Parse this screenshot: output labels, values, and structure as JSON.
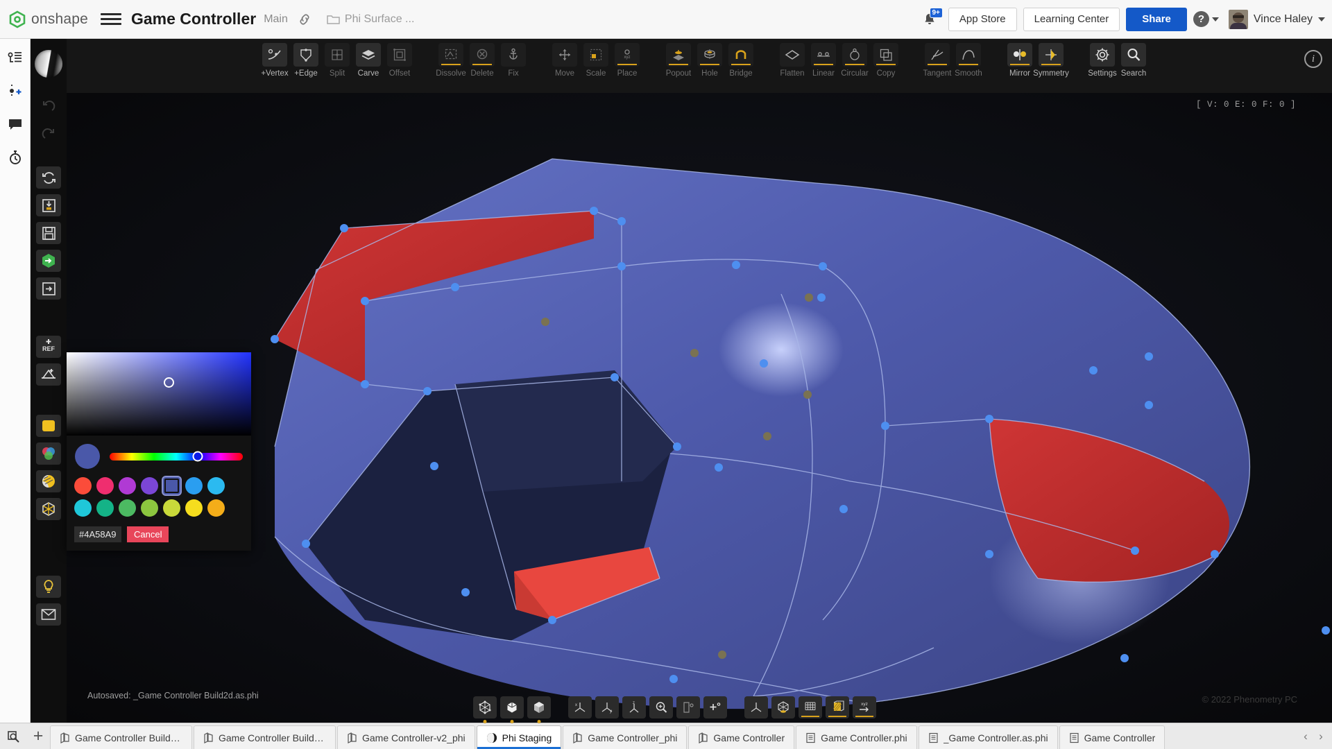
{
  "header": {
    "brand": "onshape",
    "menu_icon": "hamburger-icon",
    "document_title": "Game Controller",
    "branch": "Main",
    "link_icon": "link-icon",
    "workspace_folder": "Phi Surface ...",
    "notifications": {
      "icon": "bell-icon",
      "badge": "9+"
    },
    "app_store_label": "App Store",
    "learning_center_label": "Learning Center",
    "share_label": "Share",
    "help_glyph": "?",
    "user_name": "Vince Haley"
  },
  "rail": {
    "items": [
      {
        "name": "feature-tree-icon",
        "label": "Feature list"
      },
      {
        "name": "add-point-icon",
        "label": "Insert"
      },
      {
        "name": "comment-icon",
        "label": "Comments"
      },
      {
        "name": "history-icon",
        "label": "History"
      },
      {
        "name": "search-history-icon",
        "label": "Search history"
      }
    ]
  },
  "vtool": {
    "items": [
      {
        "name": "shading-sphere-icon",
        "style": "sphere"
      },
      {
        "name": "undo-icon",
        "style": "dim"
      },
      {
        "name": "redo-icon",
        "style": "dim"
      },
      {
        "name": "refresh-icon",
        "style": "tile"
      },
      {
        "name": "import-icon",
        "style": "tile"
      },
      {
        "name": "save-icon",
        "style": "tile"
      },
      {
        "name": "onshape-export-icon",
        "style": "tile"
      },
      {
        "name": "export-icon",
        "style": "tile"
      },
      {
        "name": "add-reference-icon",
        "style": "tile",
        "text": "+REF"
      },
      {
        "name": "add-dimension-icon",
        "style": "tile"
      },
      {
        "name": "color-fill-icon",
        "style": "tile"
      },
      {
        "name": "color-wheel-icon",
        "style": "tile"
      },
      {
        "name": "material-icon",
        "style": "tile"
      },
      {
        "name": "bounding-box-icon",
        "style": "tile"
      },
      {
        "name": "light-bulb-icon",
        "style": "tile"
      },
      {
        "name": "envelope-icon",
        "style": "tile"
      }
    ]
  },
  "ribbon": {
    "groups": [
      {
        "name": "edit-group",
        "tools": [
          {
            "label": "+Vertex",
            "icon": "add-vertex-icon",
            "state": "active"
          },
          {
            "label": "+Edge",
            "icon": "add-edge-icon",
            "state": "active"
          },
          {
            "label": "Split",
            "icon": "split-icon",
            "state": "dim"
          },
          {
            "label": "Carve",
            "icon": "carve-icon",
            "state": "active"
          },
          {
            "label": "Offset",
            "icon": "offset-icon",
            "state": "dim"
          }
        ]
      },
      {
        "name": "cleanup-group",
        "tools": [
          {
            "label": "Dissolve",
            "icon": "dissolve-icon",
            "state": "dim",
            "accent": true
          },
          {
            "label": "Delete",
            "icon": "delete-icon",
            "state": "dim",
            "accent": true
          },
          {
            "label": "Fix",
            "icon": "fix-anchor-icon",
            "state": "dim"
          }
        ]
      },
      {
        "name": "transform-group",
        "tools": [
          {
            "label": "Move",
            "icon": "move-icon",
            "state": "dim"
          },
          {
            "label": "Scale",
            "icon": "scale-icon",
            "state": "dim"
          },
          {
            "label": "Place",
            "icon": "place-icon",
            "state": "dim",
            "accent": true
          }
        ]
      },
      {
        "name": "feature-group",
        "tools": [
          {
            "label": "Popout",
            "icon": "popout-icon",
            "state": "dim",
            "accent": true
          },
          {
            "label": "Hole",
            "icon": "hole-icon",
            "state": "dim",
            "accent": true
          },
          {
            "label": "Bridge",
            "icon": "bridge-icon",
            "state": "dim",
            "accent": true
          }
        ]
      },
      {
        "name": "pattern-group",
        "tools": [
          {
            "label": "Flatten",
            "icon": "flatten-icon",
            "state": "dim"
          },
          {
            "label": "Linear",
            "icon": "linear-pattern-icon",
            "state": "dim",
            "accent": true
          },
          {
            "label": "Circular",
            "icon": "circular-pattern-icon",
            "state": "dim",
            "accent": true
          },
          {
            "label": "Copy",
            "icon": "copy-icon",
            "state": "dim",
            "accent": true
          }
        ]
      },
      {
        "name": "continuity-group",
        "tools": [
          {
            "label": "Tangent",
            "icon": "tangent-icon",
            "state": "dim",
            "accent": true
          },
          {
            "label": "Smooth",
            "icon": "smooth-icon",
            "state": "dim",
            "accent": true
          }
        ]
      },
      {
        "name": "symmetry-group",
        "tools": [
          {
            "label": "Mirror",
            "icon": "mirror-icon",
            "state": "active",
            "accent": true
          },
          {
            "label": "Symmetry",
            "icon": "symmetry-icon",
            "state": "active",
            "accent": true
          }
        ]
      },
      {
        "name": "utility-group",
        "tools": [
          {
            "label": "Settings",
            "icon": "gear-icon",
            "state": "active"
          },
          {
            "label": "Search",
            "icon": "search-icon",
            "state": "active"
          }
        ]
      }
    ],
    "info_icon": "info-icon"
  },
  "viewport": {
    "vertex_counter": "[ V: 0 E: 0 F: 0 ]",
    "autosave_status": "Autosaved: _Game Controller Build2d.as.phi",
    "copyright": "© 2022 Phenometry PC",
    "model_colors": {
      "surface_blue": "#4a58a9",
      "highlight_red": "#e03c3c",
      "dark_face": "#1c2240",
      "wire": "#b9c6ef"
    }
  },
  "view_toolbar": {
    "groups": [
      {
        "name": "display-mode-group",
        "items": [
          {
            "icon": "wireframe-view-icon",
            "dot": true
          },
          {
            "icon": "shaded-edges-view-icon",
            "dot": true
          },
          {
            "icon": "shaded-view-icon",
            "dot": true
          }
        ]
      },
      {
        "name": "orientation-group",
        "items": [
          {
            "icon": "axis-x-icon"
          },
          {
            "icon": "axis-y-icon"
          },
          {
            "icon": "axis-z-icon"
          },
          {
            "icon": "zoom-to-fit-icon"
          },
          {
            "icon": "section-view-icon"
          },
          {
            "icon": "add-view-icon"
          }
        ]
      },
      {
        "name": "display-options-group",
        "items": [
          {
            "icon": "origin-axes-icon"
          },
          {
            "icon": "render-sphere-icon"
          },
          {
            "icon": "grid-icon",
            "accent": true
          },
          {
            "icon": "texture-icon",
            "accent": true
          },
          {
            "icon": "xyz-axes-icon",
            "accent": true
          }
        ]
      }
    ]
  },
  "color_picker": {
    "name": "color-picker-panel",
    "current_swatch": "#4a58a9",
    "hex_value": "#4A58A9",
    "cancel_label": "Cancel",
    "palette_row1": [
      "#fb4c3a",
      "#ef2e6f",
      "#b03ad4",
      "#7b46d6",
      "#4a58a9",
      "#2a9ef0",
      "#2bbaf0"
    ],
    "palette_row2": [
      "#1fc7d9",
      "#14b387",
      "#4cba62",
      "#8cc63f",
      "#c9d93a",
      "#f5dd1e",
      "#f4ad19"
    ],
    "selected_index": 4
  },
  "tabbar": {
    "search_icon": "search-tab-icon",
    "add_label": "+",
    "tabs": [
      {
        "label": "Game Controller Build2...",
        "icon": "part-studio-icon",
        "active": false
      },
      {
        "label": "Game Controller Build2...",
        "icon": "part-studio-icon",
        "active": false
      },
      {
        "label": "Game Controller-v2_phi",
        "icon": "part-studio-icon",
        "active": false
      },
      {
        "label": "Phi Staging",
        "icon": "phi-sphere-icon",
        "active": true
      },
      {
        "label": "Game Controller_phi",
        "icon": "part-studio-icon",
        "active": false
      },
      {
        "label": "Game Controller",
        "icon": "part-studio-icon",
        "active": false
      },
      {
        "label": "Game Controller.phi",
        "icon": "document-icon",
        "active": false
      },
      {
        "label": "_Game Controller.as.phi",
        "icon": "document-icon",
        "active": false
      },
      {
        "label": "Game Controller",
        "icon": "document-icon",
        "active": false
      }
    ],
    "nav_prev": "‹",
    "nav_next": "›"
  }
}
